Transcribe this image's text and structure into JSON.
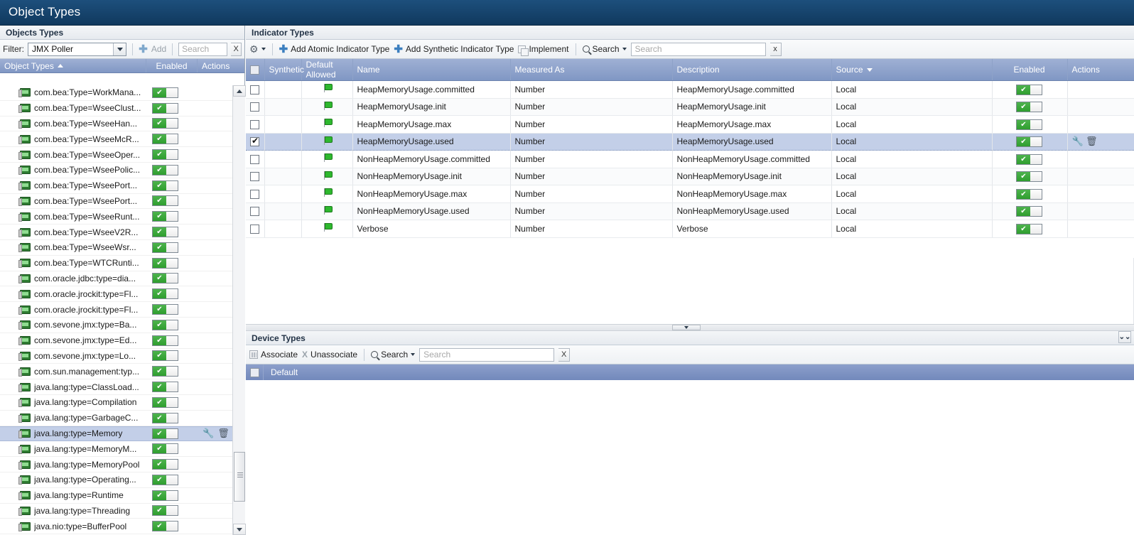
{
  "titlebar": {
    "title": "Object Types"
  },
  "left": {
    "panel_title": "Objects Types",
    "filter_label": "Filter:",
    "filter_value": "JMX Poller",
    "add_label": "Add",
    "search_placeholder": "Search",
    "clear_label": "X",
    "columns": {
      "name": "Object Types",
      "enabled": "Enabled",
      "actions": "Actions"
    },
    "items": [
      {
        "label": "com.bea:Type=WorkMana...",
        "enabled": true,
        "selected": false
      },
      {
        "label": "com.bea:Type=WseeClust...",
        "enabled": true,
        "selected": false
      },
      {
        "label": "com.bea:Type=WseeHan...",
        "enabled": true,
        "selected": false
      },
      {
        "label": "com.bea:Type=WseeMcR...",
        "enabled": true,
        "selected": false
      },
      {
        "label": "com.bea:Type=WseeOper...",
        "enabled": true,
        "selected": false
      },
      {
        "label": "com.bea:Type=WseePolic...",
        "enabled": true,
        "selected": false
      },
      {
        "label": "com.bea:Type=WseePort...",
        "enabled": true,
        "selected": false
      },
      {
        "label": "com.bea:Type=WseePort...",
        "enabled": true,
        "selected": false
      },
      {
        "label": "com.bea:Type=WseeRunt...",
        "enabled": true,
        "selected": false
      },
      {
        "label": "com.bea:Type=WseeV2R...",
        "enabled": true,
        "selected": false
      },
      {
        "label": "com.bea:Type=WseeWsr...",
        "enabled": true,
        "selected": false
      },
      {
        "label": "com.bea:Type=WTCRunti...",
        "enabled": true,
        "selected": false
      },
      {
        "label": "com.oracle.jdbc:type=dia...",
        "enabled": true,
        "selected": false
      },
      {
        "label": "com.oracle.jrockit:type=Fl...",
        "enabled": true,
        "selected": false
      },
      {
        "label": "com.oracle.jrockit:type=Fl...",
        "enabled": true,
        "selected": false
      },
      {
        "label": "com.sevone.jmx:type=Ba...",
        "enabled": true,
        "selected": false
      },
      {
        "label": "com.sevone.jmx:type=Ed...",
        "enabled": true,
        "selected": false
      },
      {
        "label": "com.sevone.jmx:type=Lo...",
        "enabled": true,
        "selected": false
      },
      {
        "label": "com.sun.management:typ...",
        "enabled": true,
        "selected": false
      },
      {
        "label": "java.lang:type=ClassLoad...",
        "enabled": true,
        "selected": false
      },
      {
        "label": "java.lang:type=Compilation",
        "enabled": true,
        "selected": false
      },
      {
        "label": "java.lang:type=GarbageC...",
        "enabled": true,
        "selected": false
      },
      {
        "label": "java.lang:type=Memory",
        "enabled": true,
        "selected": true
      },
      {
        "label": "java.lang:type=MemoryM...",
        "enabled": true,
        "selected": false
      },
      {
        "label": "java.lang:type=MemoryPool",
        "enabled": true,
        "selected": false
      },
      {
        "label": "java.lang:type=Operating...",
        "enabled": true,
        "selected": false
      },
      {
        "label": "java.lang:type=Runtime",
        "enabled": true,
        "selected": false
      },
      {
        "label": "java.lang:type=Threading",
        "enabled": true,
        "selected": false
      },
      {
        "label": "java.nio:type=BufferPool",
        "enabled": true,
        "selected": false
      }
    ]
  },
  "indicator": {
    "panel_title": "Indicator Types",
    "toolbar": {
      "add_atomic": "Add Atomic Indicator Type",
      "add_synthetic": "Add Synthetic Indicator Type",
      "implement": "Implement",
      "search_label": "Search",
      "search_placeholder": "Search",
      "clear_label": "x"
    },
    "columns": {
      "synthetic": "Synthetic",
      "default_allowed": "Default Allowed",
      "name": "Name",
      "measured_as": "Measured As",
      "description": "Description",
      "source": "Source",
      "enabled": "Enabled",
      "actions": "Actions"
    },
    "rows": [
      {
        "checked": false,
        "default_allowed": true,
        "name": "HeapMemoryUsage.committed",
        "measured_as": "Number",
        "description": "HeapMemoryUsage.committed",
        "source": "Local",
        "enabled": true,
        "selected": false
      },
      {
        "checked": false,
        "default_allowed": true,
        "name": "HeapMemoryUsage.init",
        "measured_as": "Number",
        "description": "HeapMemoryUsage.init",
        "source": "Local",
        "enabled": true,
        "selected": false
      },
      {
        "checked": false,
        "default_allowed": true,
        "name": "HeapMemoryUsage.max",
        "measured_as": "Number",
        "description": "HeapMemoryUsage.max",
        "source": "Local",
        "enabled": true,
        "selected": false
      },
      {
        "checked": true,
        "default_allowed": true,
        "name": "HeapMemoryUsage.used",
        "measured_as": "Number",
        "description": "HeapMemoryUsage.used",
        "source": "Local",
        "enabled": true,
        "selected": true
      },
      {
        "checked": false,
        "default_allowed": true,
        "name": "NonHeapMemoryUsage.committed",
        "measured_as": "Number",
        "description": "NonHeapMemoryUsage.committed",
        "source": "Local",
        "enabled": true,
        "selected": false
      },
      {
        "checked": false,
        "default_allowed": true,
        "name": "NonHeapMemoryUsage.init",
        "measured_as": "Number",
        "description": "NonHeapMemoryUsage.init",
        "source": "Local",
        "enabled": true,
        "selected": false
      },
      {
        "checked": false,
        "default_allowed": true,
        "name": "NonHeapMemoryUsage.max",
        "measured_as": "Number",
        "description": "NonHeapMemoryUsage.max",
        "source": "Local",
        "enabled": true,
        "selected": false
      },
      {
        "checked": false,
        "default_allowed": true,
        "name": "NonHeapMemoryUsage.used",
        "measured_as": "Number",
        "description": "NonHeapMemoryUsage.used",
        "source": "Local",
        "enabled": true,
        "selected": false
      },
      {
        "checked": false,
        "default_allowed": true,
        "name": "Verbose",
        "measured_as": "Number",
        "description": "Verbose",
        "source": "Local",
        "enabled": true,
        "selected": false
      }
    ]
  },
  "device": {
    "panel_title": "Device Types",
    "toolbar": {
      "associate": "Associate",
      "unassociate": "Unassociate",
      "search_label": "Search",
      "search_placeholder": "Search",
      "clear_label": "X"
    },
    "column_default": "Default"
  },
  "colors": {
    "titlebar": "#1d4f7c",
    "header_blue": "#8097c4",
    "selection": "#c3cfe8",
    "toggle_green": "#2f9e2f"
  }
}
